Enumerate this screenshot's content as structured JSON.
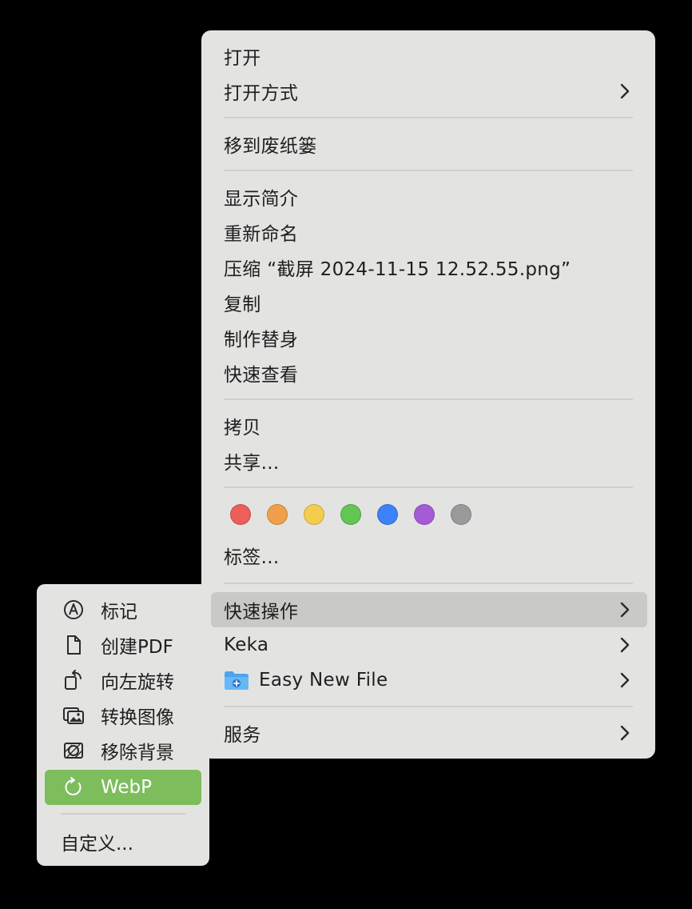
{
  "menu": {
    "items": {
      "open": "打开",
      "open_with": "打开方式",
      "move_to_trash": "移到废纸篓",
      "get_info": "显示简介",
      "rename": "重新命名",
      "compress": "压缩 “截屏 2024-11-15 12.52.55.png”",
      "duplicate": "复制",
      "make_alias": "制作替身",
      "quick_look": "快速查看",
      "copy": "拷贝",
      "share": "共享...",
      "tags": "标签...",
      "quick_actions": "快速操作",
      "keka": "Keka",
      "easy_new_file": "Easy New File",
      "services": "服务"
    },
    "tag_colors": [
      "#ec5f5a",
      "#f0a04b",
      "#f5cd4e",
      "#62c554",
      "#3e82f7",
      "#a55bd6",
      "#9a9a9c"
    ],
    "highlighted_item": "快速操作"
  },
  "submenu": {
    "items": {
      "markup": "标记",
      "create_pdf": "创建PDF",
      "rotate_left": "向左旋转",
      "convert_image": "转换图像",
      "remove_background": "移除背景",
      "webp": "WebP",
      "customize": "自定义..."
    },
    "active_item": "WebP",
    "active_color": "#7dbd5c"
  }
}
